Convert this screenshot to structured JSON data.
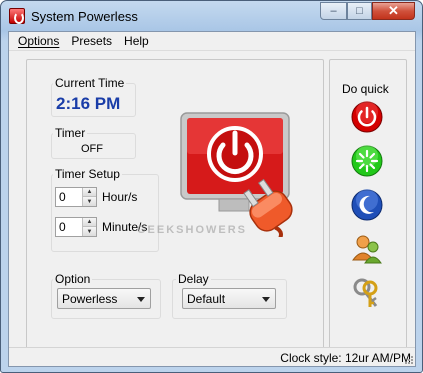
{
  "window": {
    "title": "System Powerless"
  },
  "menu": {
    "options": "Options",
    "presets": "Presets",
    "help": "Help"
  },
  "clock": {
    "label": "Current Time",
    "value": "2:16 PM"
  },
  "timer": {
    "label": "Timer",
    "value": "OFF"
  },
  "timer_setup": {
    "label": "Timer Setup",
    "hours_value": "0",
    "hours_label": "Hour/s",
    "minutes_value": "0",
    "minutes_label": "Minute/s"
  },
  "option": {
    "label": "Option",
    "selected": "Powerless"
  },
  "delay": {
    "label": "Delay",
    "selected": "Default"
  },
  "quick": {
    "label": "Do quick",
    "buttons": [
      {
        "icon": "power-off-icon",
        "color": "#d40000"
      },
      {
        "icon": "restart-icon",
        "color": "#22c81a"
      },
      {
        "icon": "sleep-moon-icon",
        "color": "#1f4fb8"
      },
      {
        "icon": "switch-user-icon",
        "color": "#e0822a"
      },
      {
        "icon": "lock-keys-icon",
        "color": "#8a8a8a"
      }
    ]
  },
  "status": {
    "text": "Clock style: 12ur AM/PM"
  },
  "watermark": "GEEKSHOWERS"
}
